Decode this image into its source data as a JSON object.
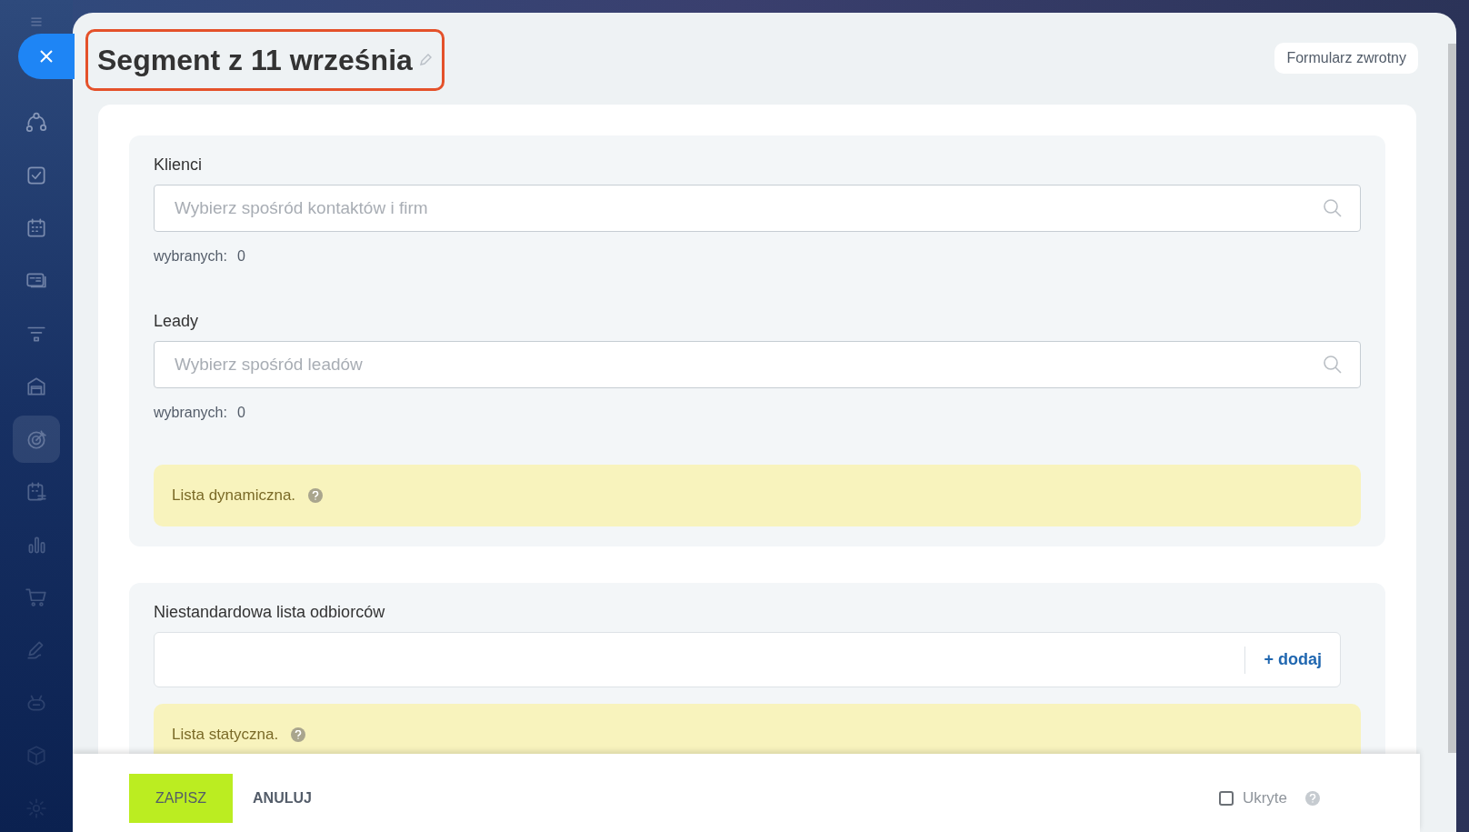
{
  "sidebar": {
    "items": [
      {
        "kind": "nodes",
        "selected": false
      },
      {
        "kind": "check",
        "selected": false
      },
      {
        "kind": "calendar",
        "selected": false
      },
      {
        "kind": "card",
        "selected": false
      },
      {
        "kind": "funnel",
        "selected": false
      },
      {
        "kind": "store",
        "selected": false
      },
      {
        "kind": "target",
        "selected": true
      },
      {
        "kind": "schedule",
        "selected": false
      },
      {
        "kind": "chart",
        "selected": false
      },
      {
        "kind": "cart",
        "selected": false
      },
      {
        "kind": "pen",
        "selected": false
      },
      {
        "kind": "robot",
        "selected": false
      },
      {
        "kind": "box",
        "selected": false
      },
      {
        "kind": "gear",
        "selected": false
      }
    ]
  },
  "title": "Segment z 11 września",
  "feedback_button": "Formularz zwrotny",
  "sections": [
    {
      "fields": [
        {
          "label": "Klienci",
          "placeholder": "Wybierz spośród kontaktów i firm",
          "count_label": "wybranych:",
          "count": "0"
        },
        {
          "label": "Leady",
          "placeholder": "Wybierz spośród leadów",
          "count_label": "wybranych:",
          "count": "0"
        }
      ],
      "note": "Lista dynamiczna."
    },
    {
      "label": "Niestandardowa lista odbiorców",
      "add_button": "+ dodaj",
      "note": "Lista statyczna."
    }
  ],
  "footer": {
    "save": "ZAPISZ",
    "cancel": "ANULUJ",
    "hidden": {
      "label": "Ukryte",
      "checked": false
    }
  }
}
